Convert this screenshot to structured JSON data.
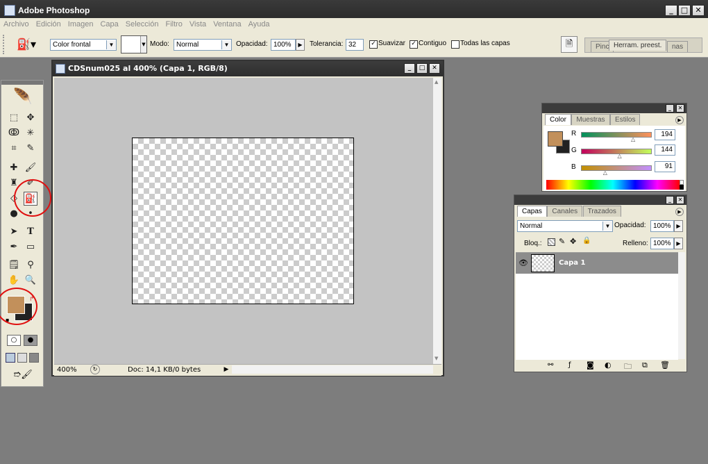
{
  "app": {
    "title": "Adobe Photoshop"
  },
  "menu": [
    "Archivo",
    "Edición",
    "Imagen",
    "Capa",
    "Selección",
    "Filtro",
    "Vista",
    "Ventana",
    "Ayuda"
  ],
  "options": {
    "fill_source": "Color frontal",
    "mode_label": "Modo:",
    "mode_value": "Normal",
    "opacity_label": "Opacidad:",
    "opacity_value": "100%",
    "tolerance_label": "Tolerancia:",
    "tolerance_value": "32",
    "smooth_label": "Suavizar",
    "contiguous_label": "Contiguo",
    "all_layers_label": "Todas las capas",
    "palette_well_tabs": [
      "Pinc",
      "Herram. preest.",
      "nas"
    ]
  },
  "document": {
    "title": "CDSnum025 al 400% (Capa 1, RGB/8)",
    "zoom": "400%",
    "doc_info": "Doc: 14,1 KB/0 bytes"
  },
  "color_panel": {
    "tabs": [
      "Color",
      "Muestras",
      "Estilos"
    ],
    "channels": [
      {
        "label": "R",
        "value": "194",
        "fraction": 0.76
      },
      {
        "label": "G",
        "value": "144",
        "fraction": 0.565
      },
      {
        "label": "B",
        "value": "91",
        "fraction": 0.357
      }
    ],
    "foreground": "#c2905b",
    "background": "#222222"
  },
  "layers_panel": {
    "tabs": [
      "Capas",
      "Canales",
      "Trazados"
    ],
    "blend_mode": "Normal",
    "opacity_label": "Opacidad:",
    "opacity_value": "100%",
    "lock_label": "Bloq.:",
    "fill_label": "Relleno:",
    "fill_value": "100%",
    "layers": [
      {
        "name": "Capa 1",
        "visible": true,
        "selected": true
      }
    ]
  }
}
